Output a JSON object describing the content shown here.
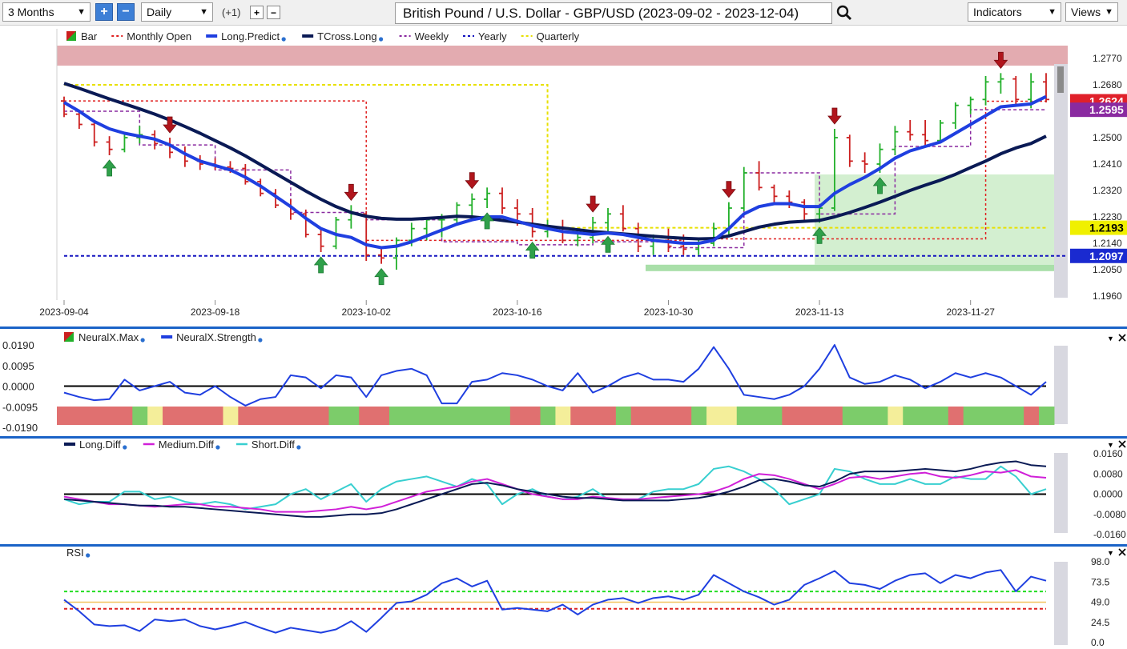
{
  "toolbar": {
    "range_value": "3 Months",
    "interval_value": "Daily",
    "increment_label": "(+1)",
    "title": "British Pound / U.S. Dollar - GBP/USD (2023-09-02 - 2023-12-04)",
    "indicators_label": "Indicators",
    "views_label": "Views"
  },
  "colors": {
    "up_bar": "#22b02a",
    "down_bar": "#cc1f1f",
    "long_predict": "#1f3fe0",
    "tcross_long": "#0a1a55",
    "monthly_open": "#e02020",
    "weekly": "#8a2aa0",
    "yearly": "#1515c0",
    "quarterly": "#e8e000",
    "neural_strength": "#1f3fe0",
    "medium_diff": "#d020d8",
    "short_diff": "#38cfd0"
  },
  "main": {
    "legend": [
      {
        "label": "Bar",
        "style": "bar-icon"
      },
      {
        "label": "Monthly Open",
        "style": "red-dash"
      },
      {
        "label": "Long.Predict",
        "style": "blue-line",
        "dot": true
      },
      {
        "label": "TCross.Long",
        "style": "navy-line",
        "dot": true
      },
      {
        "label": "Weekly",
        "style": "purple-dash"
      },
      {
        "label": "Yearly",
        "style": "blue-dash"
      },
      {
        "label": "Quarterly",
        "style": "yellow-dash"
      }
    ],
    "price_labels": [
      "1.2770",
      "1.2680",
      "1.2500",
      "1.2410",
      "1.2320",
      "1.2230",
      "1.2140",
      "1.2050",
      "1.1960"
    ],
    "date_labels": [
      "2023-09-04",
      "2023-09-18",
      "2023-10-02",
      "2023-10-16",
      "2023-10-30",
      "2023-11-13",
      "2023-11-27"
    ],
    "badges": [
      {
        "text": "1.2624",
        "color": "#e0202a"
      },
      {
        "text": "1.2595",
        "color": "#8a2aa0"
      },
      {
        "text": "1.2193",
        "color": "#f0f000"
      },
      {
        "text": "1.2097",
        "color": "#1a2ad0"
      }
    ]
  },
  "neural": {
    "legend": [
      {
        "label": "NeuralX.Max",
        "style": "bar-icon",
        "dot": true
      },
      {
        "label": "NeuralX.Strength",
        "style": "blue-line",
        "dot": true
      }
    ],
    "axis_labels": [
      "0.0190",
      "0.0095",
      "0.0000",
      "-0.0095",
      "-0.0190"
    ]
  },
  "diff": {
    "legend": [
      {
        "label": "Long.Diff",
        "style": "navy-line",
        "dot": true
      },
      {
        "label": "Medium.Diff",
        "style": "magenta-line",
        "dot": true
      },
      {
        "label": "Short.Diff",
        "style": "cyan-line",
        "dot": true
      }
    ],
    "axis_labels": [
      "0.0160",
      "0.0080",
      "0.0000",
      "-0.0080",
      "-0.0160"
    ]
  },
  "rsi": {
    "legend": [
      {
        "label": "RSI",
        "style": "none",
        "dot": true
      }
    ],
    "axis_labels": [
      "98.0",
      "73.5",
      "49.0",
      "24.5",
      "0.0"
    ]
  },
  "chart_data": {
    "type": "bar",
    "dates": [
      "2023-09-04",
      "2023-09-05",
      "2023-09-06",
      "2023-09-07",
      "2023-09-08",
      "2023-09-11",
      "2023-09-12",
      "2023-09-13",
      "2023-09-14",
      "2023-09-15",
      "2023-09-18",
      "2023-09-19",
      "2023-09-20",
      "2023-09-21",
      "2023-09-22",
      "2023-09-25",
      "2023-09-26",
      "2023-09-27",
      "2023-09-28",
      "2023-09-29",
      "2023-10-02",
      "2023-10-03",
      "2023-10-04",
      "2023-10-05",
      "2023-10-06",
      "2023-10-09",
      "2023-10-10",
      "2023-10-11",
      "2023-10-12",
      "2023-10-13",
      "2023-10-16",
      "2023-10-17",
      "2023-10-18",
      "2023-10-19",
      "2023-10-20",
      "2023-10-23",
      "2023-10-24",
      "2023-10-25",
      "2023-10-26",
      "2023-10-27",
      "2023-10-30",
      "2023-10-31",
      "2023-11-01",
      "2023-11-02",
      "2023-11-03",
      "2023-11-06",
      "2023-11-07",
      "2023-11-08",
      "2023-11-09",
      "2023-11-10",
      "2023-11-13",
      "2023-11-14",
      "2023-11-15",
      "2023-11-16",
      "2023-11-17",
      "2023-11-20",
      "2023-11-21",
      "2023-11-22",
      "2023-11-23",
      "2023-11-24",
      "2023-11-27",
      "2023-11-28",
      "2023-11-29",
      "2023-11-30",
      "2023-12-01",
      "2023-12-04"
    ],
    "ohlc": [
      [
        1.2625,
        1.264,
        1.257,
        1.258
      ],
      [
        1.258,
        1.2595,
        1.253,
        1.2545
      ],
      [
        1.2545,
        1.256,
        1.247,
        1.2485
      ],
      [
        1.2485,
        1.2505,
        1.244,
        1.246
      ],
      [
        1.246,
        1.251,
        1.245,
        1.25
      ],
      [
        1.25,
        1.254,
        1.248,
        1.251
      ],
      [
        1.251,
        1.2525,
        1.246,
        1.248
      ],
      [
        1.248,
        1.25,
        1.243,
        1.245
      ],
      [
        1.245,
        1.247,
        1.24,
        1.242
      ],
      [
        1.242,
        1.244,
        1.239,
        1.241
      ],
      [
        1.241,
        1.243,
        1.239,
        1.24
      ],
      [
        1.24,
        1.242,
        1.238,
        1.2395
      ],
      [
        1.2395,
        1.241,
        1.234,
        1.235
      ],
      [
        1.235,
        1.236,
        1.23,
        1.231
      ],
      [
        1.231,
        1.2325,
        1.226,
        1.227
      ],
      [
        1.227,
        1.229,
        1.222,
        1.224
      ],
      [
        1.224,
        1.2255,
        1.216,
        1.217
      ],
      [
        1.217,
        1.219,
        1.211,
        1.213
      ],
      [
        1.213,
        1.223,
        1.212,
        1.222
      ],
      [
        1.222,
        1.227,
        1.219,
        1.224
      ],
      [
        1.224,
        1.225,
        1.208,
        1.21
      ],
      [
        1.21,
        1.212,
        1.207,
        1.209
      ],
      [
        1.209,
        1.216,
        1.205,
        1.215
      ],
      [
        1.215,
        1.221,
        1.213,
        1.219
      ],
      [
        1.219,
        1.223,
        1.215,
        1.222
      ],
      [
        1.222,
        1.224,
        1.216,
        1.222
      ],
      [
        1.222,
        1.228,
        1.22,
        1.227
      ],
      [
        1.227,
        1.231,
        1.223,
        1.229
      ],
      [
        1.229,
        1.233,
        1.226,
        1.231
      ],
      [
        1.231,
        1.233,
        1.224,
        1.226
      ],
      [
        1.226,
        1.229,
        1.22,
        1.224
      ],
      [
        1.224,
        1.226,
        1.216,
        1.218
      ],
      [
        1.218,
        1.222,
        1.216,
        1.219
      ],
      [
        1.219,
        1.222,
        1.214,
        1.215
      ],
      [
        1.215,
        1.219,
        1.213,
        1.216
      ],
      [
        1.216,
        1.223,
        1.214,
        1.221
      ],
      [
        1.221,
        1.226,
        1.218,
        1.224
      ],
      [
        1.224,
        1.227,
        1.218,
        1.219
      ],
      [
        1.219,
        1.221,
        1.211,
        1.213
      ],
      [
        1.213,
        1.217,
        1.21,
        1.215
      ],
      [
        1.215,
        1.219,
        1.211,
        1.213
      ],
      [
        1.213,
        1.217,
        1.21,
        1.212
      ],
      [
        1.212,
        1.215,
        1.21,
        1.214
      ],
      [
        1.214,
        1.221,
        1.213,
        1.219
      ],
      [
        1.219,
        1.228,
        1.217,
        1.226
      ],
      [
        1.226,
        1.24,
        1.225,
        1.238
      ],
      [
        1.238,
        1.242,
        1.232,
        1.233
      ],
      [
        1.233,
        1.234,
        1.228,
        1.23
      ],
      [
        1.23,
        1.232,
        1.226,
        1.228
      ],
      [
        1.228,
        1.229,
        1.222,
        1.224
      ],
      [
        1.224,
        1.227,
        1.221,
        1.226
      ],
      [
        1.226,
        1.253,
        1.225,
        1.25
      ],
      [
        1.25,
        1.251,
        1.24,
        1.242
      ],
      [
        1.242,
        1.245,
        1.238,
        1.241
      ],
      [
        1.241,
        1.248,
        1.238,
        1.246
      ],
      [
        1.246,
        1.254,
        1.244,
        1.252
      ],
      [
        1.252,
        1.256,
        1.249,
        1.251
      ],
      [
        1.251,
        1.256,
        1.247,
        1.249
      ],
      [
        1.249,
        1.256,
        1.248,
        1.255
      ],
      [
        1.255,
        1.262,
        1.253,
        1.261
      ],
      [
        1.261,
        1.264,
        1.258,
        1.263
      ],
      [
        1.263,
        1.271,
        1.261,
        1.269
      ],
      [
        1.269,
        1.272,
        1.265,
        1.27
      ],
      [
        1.27,
        1.271,
        1.261,
        1.263
      ],
      [
        1.263,
        1.272,
        1.26,
        1.269
      ],
      [
        1.269,
        1.272,
        1.262,
        1.263
      ]
    ],
    "long_predict": [
      1.262,
      1.259,
      1.2555,
      1.253,
      1.2515,
      1.2505,
      1.2495,
      1.2475,
      1.2445,
      1.242,
      1.2405,
      1.239,
      1.2365,
      1.2335,
      1.23,
      1.2265,
      1.2225,
      1.219,
      1.217,
      1.216,
      1.2135,
      1.2125,
      1.213,
      1.2145,
      1.2165,
      1.2185,
      1.2205,
      1.222,
      1.223,
      1.223,
      1.2215,
      1.22,
      1.219,
      1.218,
      1.2175,
      1.217,
      1.2175,
      1.217,
      1.216,
      1.215,
      1.2145,
      1.214,
      1.214,
      1.215,
      1.219,
      1.224,
      1.2265,
      1.2275,
      1.2275,
      1.2265,
      1.2265,
      1.231,
      1.234,
      1.2365,
      1.2395,
      1.243,
      1.2455,
      1.247,
      1.2485,
      1.2515,
      1.2545,
      1.2575,
      1.2605,
      1.261,
      1.2615,
      1.264
    ],
    "tcross_long": [
      1.2685,
      1.2668,
      1.265,
      1.2632,
      1.2615,
      1.2598,
      1.258,
      1.256,
      1.2538,
      1.2515,
      1.249,
      1.2465,
      1.2438,
      1.2408,
      1.2378,
      1.2348,
      1.2318,
      1.229,
      1.2265,
      1.2245,
      1.2232,
      1.2225,
      1.2222,
      1.2222,
      1.2225,
      1.2228,
      1.2232,
      1.223,
      1.2225,
      1.2218,
      1.2212,
      1.2205,
      1.2198,
      1.2192,
      1.2186,
      1.218,
      1.2176,
      1.2172,
      1.2168,
      1.2164,
      1.216,
      1.2157,
      1.2155,
      1.2156,
      1.2165,
      1.218,
      1.2195,
      1.2205,
      1.2212,
      1.2215,
      1.2218,
      1.223,
      1.2245,
      1.2262,
      1.228,
      1.23,
      1.232,
      1.2338,
      1.2355,
      1.2375,
      1.2398,
      1.242,
      1.2445,
      1.2465,
      1.248,
      1.2505
    ],
    "yearly": 1.2097,
    "quarterly": [
      [
        0,
        32,
        1.268
      ],
      [
        32,
        66,
        1.2193
      ]
    ],
    "monthly_open": [
      [
        0,
        20,
        1.2625
      ],
      [
        20,
        41,
        1.215
      ],
      [
        41,
        61,
        1.2155
      ],
      [
        61,
        66,
        1.2624
      ]
    ],
    "weekly": [
      [
        0,
        5,
        1.259
      ],
      [
        5,
        10,
        1.2475
      ],
      [
        10,
        15,
        1.239
      ],
      [
        15,
        20,
        1.2245
      ],
      [
        20,
        25,
        1.222
      ],
      [
        25,
        30,
        1.2145
      ],
      [
        30,
        35,
        1.2135
      ],
      [
        35,
        40,
        1.2145
      ],
      [
        40,
        45,
        1.2125
      ],
      [
        45,
        50,
        1.238
      ],
      [
        50,
        55,
        1.224
      ],
      [
        55,
        60,
        1.247
      ],
      [
        60,
        66,
        1.2595
      ]
    ],
    "arrows_up": [
      3,
      17,
      21,
      28,
      31,
      36,
      50,
      54
    ],
    "arrows_down": [
      7,
      19,
      27,
      35,
      44,
      51,
      62
    ],
    "neural_strength": [
      -0.003,
      -0.005,
      -0.0065,
      -0.006,
      0.003,
      -0.002,
      0.0,
      0.002,
      -0.003,
      -0.004,
      0.0,
      -0.005,
      -0.009,
      -0.006,
      -0.005,
      0.005,
      0.004,
      -0.001,
      0.005,
      0.004,
      -0.005,
      0.005,
      0.007,
      0.008,
      0.005,
      -0.008,
      -0.008,
      0.002,
      0.003,
      0.006,
      0.005,
      0.003,
      0.0,
      -0.002,
      0.006,
      -0.003,
      0.0,
      0.004,
      0.006,
      0.003,
      0.003,
      0.002,
      0.008,
      0.018,
      0.008,
      -0.004,
      -0.005,
      -0.006,
      -0.004,
      0.0,
      0.008,
      0.019,
      0.004,
      0.001,
      0.002,
      0.005,
      0.003,
      -0.001,
      0.002,
      0.006,
      0.004,
      0.006,
      0.004,
      0.0,
      -0.004,
      0.002
    ],
    "neural_max": [
      "r",
      "r",
      "r",
      "r",
      "r",
      "g",
      "y",
      "r",
      "r",
      "r",
      "r",
      "y",
      "r",
      "r",
      "r",
      "r",
      "r",
      "r",
      "g",
      "g",
      "r",
      "r",
      "g",
      "g",
      "g",
      "g",
      "g",
      "g",
      "g",
      "g",
      "r",
      "r",
      "g",
      "y",
      "r",
      "r",
      "r",
      "g",
      "r",
      "r",
      "r",
      "r",
      "g",
      "y",
      "y",
      "g",
      "g",
      "g",
      "r",
      "r",
      "r",
      "r",
      "g",
      "g",
      "g",
      "y",
      "g",
      "g",
      "g",
      "r",
      "g",
      "g",
      "g",
      "g",
      "r",
      "g"
    ],
    "long_diff": [
      -0.002,
      -0.0025,
      -0.003,
      -0.0035,
      -0.004,
      -0.0045,
      -0.0045,
      -0.005,
      -0.005,
      -0.0055,
      -0.006,
      -0.0065,
      -0.007,
      -0.0075,
      -0.008,
      -0.0085,
      -0.009,
      -0.009,
      -0.0085,
      -0.008,
      -0.008,
      -0.0075,
      -0.006,
      -0.004,
      -0.002,
      0.0,
      0.002,
      0.004,
      0.0045,
      0.0035,
      0.002,
      0.001,
      0.0,
      -0.001,
      -0.0015,
      -0.0015,
      -0.002,
      -0.0025,
      -0.0025,
      -0.0025,
      -0.0025,
      -0.002,
      -0.0015,
      -0.0005,
      0.001,
      0.003,
      0.0055,
      0.006,
      0.005,
      0.0035,
      0.003,
      0.005,
      0.008,
      0.009,
      0.009,
      0.009,
      0.0095,
      0.01,
      0.0095,
      0.009,
      0.01,
      0.0115,
      0.0125,
      0.013,
      0.0115,
      0.011
    ],
    "medium_diff": [
      -0.001,
      -0.002,
      -0.003,
      -0.004,
      -0.004,
      -0.0045,
      -0.005,
      -0.0045,
      -0.004,
      -0.004,
      -0.005,
      -0.005,
      -0.0055,
      -0.006,
      -0.007,
      -0.007,
      -0.007,
      -0.0065,
      -0.006,
      -0.005,
      -0.006,
      -0.005,
      -0.003,
      -0.001,
      0.001,
      0.002,
      0.003,
      0.005,
      0.006,
      0.004,
      0.002,
      0.0,
      -0.001,
      -0.002,
      -0.002,
      -0.001,
      -0.0015,
      -0.002,
      -0.002,
      -0.0015,
      -0.001,
      -0.0005,
      0.0,
      0.001,
      0.003,
      0.006,
      0.008,
      0.0075,
      0.006,
      0.004,
      0.002,
      0.004,
      0.0065,
      0.007,
      0.006,
      0.007,
      0.008,
      0.0085,
      0.007,
      0.0065,
      0.0075,
      0.009,
      0.0085,
      0.0095,
      0.007,
      0.0065
    ],
    "short_diff": [
      -0.002,
      -0.004,
      -0.003,
      -0.003,
      0.001,
      0.001,
      -0.002,
      -0.001,
      -0.003,
      -0.004,
      -0.003,
      -0.004,
      -0.006,
      -0.005,
      -0.004,
      0.0,
      0.002,
      -0.002,
      0.001,
      0.004,
      -0.003,
      0.002,
      0.005,
      0.006,
      0.007,
      0.005,
      0.003,
      0.006,
      0.004,
      -0.004,
      0.0,
      0.002,
      -0.001,
      -0.002,
      -0.001,
      0.002,
      -0.002,
      -0.002,
      -0.002,
      0.001,
      0.002,
      0.002,
      0.004,
      0.01,
      0.011,
      0.009,
      0.006,
      0.002,
      -0.004,
      -0.002,
      0.0,
      0.01,
      0.009,
      0.006,
      0.004,
      0.004,
      0.006,
      0.004,
      0.004,
      0.007,
      0.006,
      0.006,
      0.011,
      0.007,
      0.0,
      0.002
    ],
    "rsi": [
      52,
      38,
      22,
      20,
      21,
      14,
      28,
      26,
      28,
      20,
      16,
      20,
      25,
      18,
      12,
      18,
      15,
      12,
      16,
      26,
      13,
      30,
      48,
      50,
      58,
      72,
      78,
      68,
      75,
      40,
      42,
      40,
      38,
      46,
      34,
      46,
      52,
      54,
      48,
      54,
      56,
      52,
      58,
      82,
      72,
      62,
      55,
      46,
      52,
      70,
      78,
      87,
      72,
      70,
      65,
      75,
      82,
      84,
      72,
      82,
      78,
      85,
      88,
      62,
      80,
      75
    ],
    "rsi_levels": {
      "upper": 62,
      "middle": 49,
      "lower": 41
    }
  }
}
